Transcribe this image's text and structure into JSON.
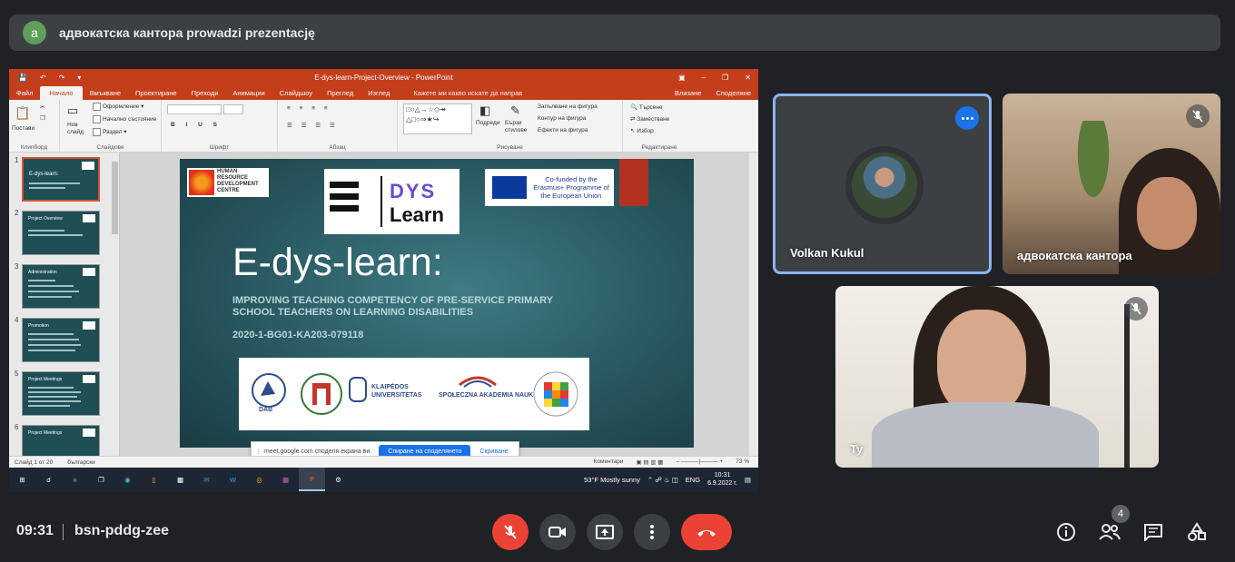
{
  "presenter_bar": {
    "avatar_letter": "a",
    "text": "адвокатска кантора prowadzi prezentację"
  },
  "powerpoint": {
    "window_title": "E-dys-learn-Project-Overview - PowerPoint",
    "tabs": [
      "Файл",
      "Начало",
      "Вмъкване",
      "Проектиране",
      "Преходи",
      "Анимации",
      "Слайдшоу",
      "Преглед",
      "Изглед"
    ],
    "active_tab": "Начало",
    "tell_me": "Кажете ми какво искате да направ",
    "sign_in": "Влизане",
    "share": "Споделяне",
    "ribbon": {
      "paste": "Постави",
      "new_slide": "Нов слайд",
      "layout": "Оформление",
      "reset": "Начално състояние",
      "section": "Раздел",
      "clipboard": "Клипборд",
      "slides": "Слайдове",
      "font": "Шрифт",
      "paragraph": "Абзац",
      "arrange": "Подреди",
      "quick_styles": "Бързи стилове",
      "shape_fill": "Запълване на фигура",
      "shape_outline": "Контур на фигура",
      "shape_effects": "Ефекти на фигура",
      "drawing": "Рисуване",
      "find": "Търсене",
      "replace": "Заместване",
      "select": "Избор",
      "editing": "Редактиране"
    },
    "thumbnails": [
      {
        "num": "1",
        "title": "E-dys-learn:"
      },
      {
        "num": "2",
        "title": "Project Overview"
      },
      {
        "num": "3",
        "title": "Administration"
      },
      {
        "num": "4",
        "title": "Promotion"
      },
      {
        "num": "5",
        "title": "Project Meetings"
      },
      {
        "num": "6",
        "title": "Project Meetings"
      }
    ],
    "slide": {
      "hrdc": "HUMAN RESOURCE DEVELOPMENT CENTRE",
      "dys": "DYS",
      "learn": "Learn",
      "eu": "Co-funded by the Erasmus+ Programme of the European Union",
      "title": "E-dys-learn:",
      "subtitle": "IMPROVING TEACHING COMPETENCY OF PRE-SERVICE PRIMARY SCHOOL TEACHERS ON LEARNING DISABILITIES",
      "code": "2020-1-BG01-KA203-079118",
      "partners": {
        "dab": "DAB",
        "klaipeda": "KLAIPĖDOS UNIVERSITETAS",
        "spoleczna": "SPOŁECZNA AKADEMIA NAUK"
      }
    },
    "share_notice": {
      "message": "meet.google.com споделя екрана ви.",
      "stop": "Спиране на споделянето",
      "hide": "Скриване"
    },
    "statusbar": {
      "slide_count": "Слайд 1 от 20",
      "language": "български",
      "comments": "Коментари",
      "zoom": "73 %"
    },
    "taskbar": {
      "weather": "53°F Mostly sunny",
      "lang": "ENG",
      "time": "10:31",
      "date": "6.9.2022 г."
    }
  },
  "participants": [
    {
      "name": "Volkan Kukul"
    },
    {
      "name": "адвокатска кантора"
    },
    {
      "name": "Ty"
    }
  ],
  "bottom_bar": {
    "time": "09:31",
    "meeting_code": "bsn-pddg-zee",
    "participants_count": "4"
  }
}
